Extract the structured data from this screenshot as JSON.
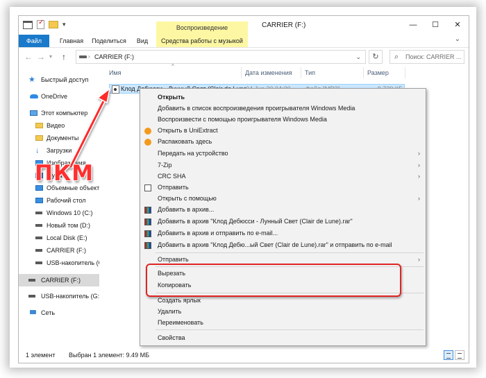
{
  "window": {
    "title": "CARRIER (F:)",
    "contextual_tab_header": "Воспроизведение",
    "minimize": "—",
    "maximize": "☐",
    "close": "✕"
  },
  "ribbon": {
    "tabs": [
      "Файл",
      "Главная",
      "Поделиться",
      "Вид",
      "Средства работы с музыкой"
    ]
  },
  "address": {
    "path": "CARRIER (F:)",
    "search_placeholder": "Поиск: CARRIER ..."
  },
  "sidebar": {
    "items": [
      {
        "label": "Быстрый доступ",
        "icon": "star-icon"
      },
      {
        "label": "OneDrive",
        "icon": "cloud-icon"
      },
      {
        "label": "Этот компьютер",
        "icon": "computer-icon"
      },
      {
        "label": "Видео",
        "icon": "folder-icon"
      },
      {
        "label": "Документы",
        "icon": "folder-icon"
      },
      {
        "label": "Загрузки",
        "icon": "download-icon"
      },
      {
        "label": "Изображения",
        "icon": "folder-icon"
      },
      {
        "label": "Музыка",
        "icon": "folder-icon"
      },
      {
        "label": "Объемные объекты",
        "icon": "folder-icon"
      },
      {
        "label": "Рабочий стол",
        "icon": "folder-icon"
      },
      {
        "label": "Windows 10 (C:)",
        "icon": "drive-icon"
      },
      {
        "label": "Новый том (D:)",
        "icon": "drive-icon"
      },
      {
        "label": "Local Disk (E:)",
        "icon": "drive-icon"
      },
      {
        "label": "CARRIER (F:)",
        "icon": "drive-icon"
      },
      {
        "label": "USB-накопитель (G:)",
        "icon": "drive-icon"
      },
      {
        "label": "CARRIER (F:)",
        "icon": "drive-icon"
      },
      {
        "label": "USB-накопитель (G:)",
        "icon": "drive-icon"
      },
      {
        "label": "Сеть",
        "icon": "network-icon"
      }
    ]
  },
  "columns": [
    "Имя",
    "Дата изменения",
    "Тип",
    "Размер"
  ],
  "file": {
    "name": "Клод Дебюсси - Лунный Свет (Clair de Lune).mp3",
    "date": "04.Jun.20 04:20",
    "type": "Файл \"MP3\"",
    "size": "9 720 КБ"
  },
  "context_menu": {
    "items": [
      {
        "label": "Открыть",
        "bold": true
      },
      {
        "label": "Добавить в список воспроизведения проигрывателя Windows Media"
      },
      {
        "label": "Воспроизвести с помощью проигрывателя Windows Media"
      },
      {
        "label": "Открыть в UniExtract",
        "icon": "uniextract-icon"
      },
      {
        "label": "Распаковать здесь",
        "icon": "uniextract-icon"
      },
      {
        "label": "Передать на устройство",
        "submenu": true
      },
      {
        "label": "7-Zip",
        "submenu": true
      },
      {
        "label": "CRC SHA",
        "submenu": true
      },
      {
        "label": "Отправить",
        "icon": "share-icon"
      },
      {
        "label": "Открыть с помощью",
        "submenu": true
      },
      {
        "label": "Добавить в архив...",
        "icon": "winrar-icon"
      },
      {
        "label": "Добавить в архив \"Клод Дебюсси - Лунный Свет (Clair de Lune).rar\"",
        "icon": "winrar-icon"
      },
      {
        "label": "Добавить в архив и отправить по e-mail...",
        "icon": "winrar-icon"
      },
      {
        "label": "Добавить в архив \"Клод Дебю...ый Свет (Clair de Lune).rar\" и отправить по e-mail",
        "icon": "winrar-icon"
      },
      {
        "label": "Отправить",
        "submenu": true
      },
      {
        "label": "Вырезать"
      },
      {
        "label": "Копировать"
      },
      {
        "label": "Создать ярлык"
      },
      {
        "label": "Удалить"
      },
      {
        "label": "Переименовать"
      },
      {
        "label": "Свойства"
      }
    ]
  },
  "status": {
    "count": "1 элемент",
    "selected": "Выбран 1 элемент: 9.49 МБ"
  },
  "annotation": {
    "label": "ПКМ",
    "color": "#ff3030"
  },
  "colors": {
    "accent": "#1979ca",
    "contextual_tab": "#fdf7a3",
    "selection": "#cce8ff",
    "highlight_box": "#e02424"
  }
}
